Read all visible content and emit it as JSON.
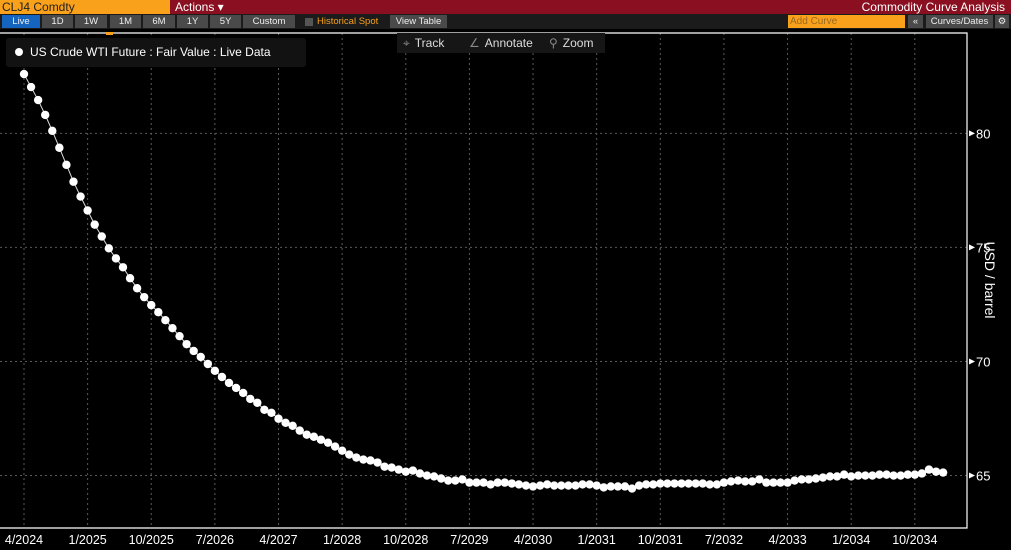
{
  "header": {
    "ticker": "CLJ4 Comdty",
    "actions": "Actions ▾",
    "title": "Commodity Curve Analysis"
  },
  "toolbar": {
    "ranges": [
      "Live",
      "1D",
      "1W",
      "1M",
      "6M",
      "1Y",
      "5Y",
      "Custom"
    ],
    "active": "Live",
    "historical_spot": "Historical Spot",
    "view_table": "View Table",
    "add_curve_placeholder": "Add Curve",
    "collapse": "«",
    "curves_dates": "Curves/Dates",
    "settings_icon": "gear-icon"
  },
  "chart_tools": {
    "track": "Track",
    "annotate": "Annotate",
    "zoom": "Zoom"
  },
  "colors": {
    "accent": "#f9a11b",
    "header": "#8a0f20",
    "active": "#1565c0",
    "series": "#ffffff"
  },
  "chart_data": {
    "type": "line",
    "title": "",
    "legend": [
      "US Crude WTI Future : Fair Value : Live Data"
    ],
    "legend_position": "top-left",
    "xlabel": "",
    "ylabel": "USD / barrel",
    "x_start": "4/2024",
    "x_frequency": "monthly",
    "xticks": [
      "4/2024",
      "1/2025",
      "10/2025",
      "7/2026",
      "4/2027",
      "1/2028",
      "10/2028",
      "7/2029",
      "4/2030",
      "1/2031",
      "10/2031",
      "7/2032",
      "4/2033",
      "1/2034",
      "10/2034"
    ],
    "yticks": [
      65,
      70,
      75,
      80
    ],
    "ylim": [
      62.7,
      84.4
    ],
    "grid": true,
    "values": [
      82.6,
      82.03,
      81.46,
      80.81,
      80.11,
      79.37,
      78.62,
      77.88,
      77.23,
      76.62,
      76.0,
      75.48,
      74.96,
      74.52,
      74.13,
      73.65,
      73.21,
      72.82,
      72.47,
      72.16,
      71.81,
      71.46,
      71.11,
      70.76,
      70.46,
      70.2,
      69.89,
      69.59,
      69.32,
      69.06,
      68.84,
      68.62,
      68.36,
      68.19,
      67.88,
      67.75,
      67.49,
      67.31,
      67.18,
      66.97,
      66.79,
      66.7,
      66.57,
      66.44,
      66.27,
      66.09,
      65.92,
      65.79,
      65.7,
      65.66,
      65.57,
      65.39,
      65.35,
      65.26,
      65.17,
      65.22,
      65.09,
      65.0,
      64.96,
      64.87,
      64.78,
      64.78,
      64.83,
      64.69,
      64.69,
      64.69,
      64.61,
      64.69,
      64.69,
      64.65,
      64.61,
      64.56,
      64.52,
      64.56,
      64.61,
      64.56,
      64.56,
      64.56,
      64.56,
      64.61,
      64.61,
      64.56,
      64.48,
      64.52,
      64.52,
      64.52,
      64.43,
      64.56,
      64.61,
      64.61,
      64.65,
      64.65,
      64.65,
      64.65,
      64.65,
      64.65,
      64.65,
      64.61,
      64.61,
      64.69,
      64.74,
      64.78,
      64.74,
      64.74,
      64.83,
      64.69,
      64.69,
      64.69,
      64.69,
      64.78,
      64.83,
      64.83,
      64.87,
      64.91,
      64.96,
      64.96,
      65.04,
      64.96,
      65.0,
      65.0,
      65.0,
      65.04,
      65.04,
      65.0,
      65.0,
      65.04,
      65.04,
      65.09,
      65.26,
      65.17,
      65.13
    ]
  }
}
